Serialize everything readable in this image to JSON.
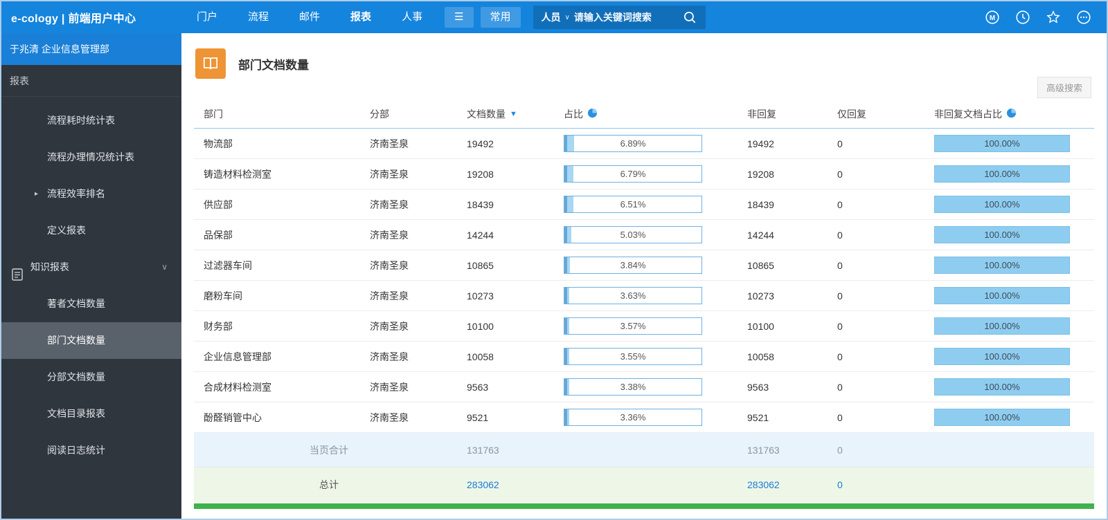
{
  "topbar": {
    "logo": "e-cology | 前端用户中心",
    "nav": [
      {
        "label": "门户",
        "active": false
      },
      {
        "label": "流程",
        "active": false
      },
      {
        "label": "邮件",
        "active": false
      },
      {
        "label": "报表",
        "active": true
      },
      {
        "label": "人事",
        "active": false
      }
    ],
    "menu_glyph": "☰",
    "quick_label": "常用",
    "search_scope": "人员",
    "search_chevron": "∨",
    "search_placeholder": "请输入关键词搜索"
  },
  "sidebar": {
    "user": "于兆清 企业信息管理部",
    "section": "报表",
    "items": [
      {
        "label": "流程耗时统计表",
        "type": "child"
      },
      {
        "label": "流程办理情况统计表",
        "type": "child"
      },
      {
        "label": "流程效率排名",
        "type": "child",
        "arrow": true
      },
      {
        "label": "定义报表",
        "type": "child"
      },
      {
        "label": "知识报表",
        "type": "group",
        "expanded": true
      },
      {
        "label": "著者文档数量",
        "type": "child"
      },
      {
        "label": "部门文档数量",
        "type": "child",
        "selected": true
      },
      {
        "label": "分部文档数量",
        "type": "child"
      },
      {
        "label": "文档目录报表",
        "type": "child"
      },
      {
        "label": "阅读日志统计",
        "type": "child"
      }
    ]
  },
  "main": {
    "title": "部门文档数量",
    "advanced_search_label": "高级搜索",
    "table": {
      "columns": [
        {
          "label": "部门"
        },
        {
          "label": "分部"
        },
        {
          "label": "文档数量",
          "sort": "desc"
        },
        {
          "label": "占比",
          "pie": true
        },
        {
          "label": "非回复"
        },
        {
          "label": "仅回复"
        },
        {
          "label": "非回复文档占比",
          "pie": true
        }
      ],
      "rows": [
        {
          "dept": "物流部",
          "branch": "济南圣泉",
          "count": "19492",
          "pct": "6.89%",
          "pct_val": 6.89,
          "non_reply": "19492",
          "reply_only": "0",
          "nr_pct": "100.00%",
          "nr_val": 100
        },
        {
          "dept": "铸造材料检测室",
          "branch": "济南圣泉",
          "count": "19208",
          "pct": "6.79%",
          "pct_val": 6.79,
          "non_reply": "19208",
          "reply_only": "0",
          "nr_pct": "100.00%",
          "nr_val": 100
        },
        {
          "dept": "供应部",
          "branch": "济南圣泉",
          "count": "18439",
          "pct": "6.51%",
          "pct_val": 6.51,
          "non_reply": "18439",
          "reply_only": "0",
          "nr_pct": "100.00%",
          "nr_val": 100
        },
        {
          "dept": "品保部",
          "branch": "济南圣泉",
          "count": "14244",
          "pct": "5.03%",
          "pct_val": 5.03,
          "non_reply": "14244",
          "reply_only": "0",
          "nr_pct": "100.00%",
          "nr_val": 100
        },
        {
          "dept": "过滤器车间",
          "branch": "济南圣泉",
          "count": "10865",
          "pct": "3.84%",
          "pct_val": 3.84,
          "non_reply": "10865",
          "reply_only": "0",
          "nr_pct": "100.00%",
          "nr_val": 100
        },
        {
          "dept": "磨粉车间",
          "branch": "济南圣泉",
          "count": "10273",
          "pct": "3.63%",
          "pct_val": 3.63,
          "non_reply": "10273",
          "reply_only": "0",
          "nr_pct": "100.00%",
          "nr_val": 100
        },
        {
          "dept": "财务部",
          "branch": "济南圣泉",
          "count": "10100",
          "pct": "3.57%",
          "pct_val": 3.57,
          "non_reply": "10100",
          "reply_only": "0",
          "nr_pct": "100.00%",
          "nr_val": 100
        },
        {
          "dept": "企业信息管理部",
          "branch": "济南圣泉",
          "count": "10058",
          "pct": "3.55%",
          "pct_val": 3.55,
          "non_reply": "10058",
          "reply_only": "0",
          "nr_pct": "100.00%",
          "nr_val": 100
        },
        {
          "dept": "合成材料检测室",
          "branch": "济南圣泉",
          "count": "9563",
          "pct": "3.38%",
          "pct_val": 3.38,
          "non_reply": "9563",
          "reply_only": "0",
          "nr_pct": "100.00%",
          "nr_val": 100
        },
        {
          "dept": "酚醛销管中心",
          "branch": "济南圣泉",
          "count": "9521",
          "pct": "3.36%",
          "pct_val": 3.36,
          "non_reply": "9521",
          "reply_only": "0",
          "nr_pct": "100.00%",
          "nr_val": 100
        }
      ],
      "page_total": {
        "label": "当页合计",
        "count": "131763",
        "non_reply": "131763",
        "reply_only": "0"
      },
      "grand_total": {
        "label": "总计",
        "count": "283062",
        "non_reply": "283062",
        "reply_only": "0"
      }
    }
  },
  "colors": {
    "topbar_blue": "#1584dd",
    "sidebar_dark": "#30363e",
    "accent_blue": "#1a79d8",
    "bar_fill": "#a7d7f3",
    "orange_icon": "#ef9434",
    "page_total_bg": "#e9f3fb",
    "grand_total_bg": "#eef7e7",
    "green_strip": "#3fb24c"
  }
}
